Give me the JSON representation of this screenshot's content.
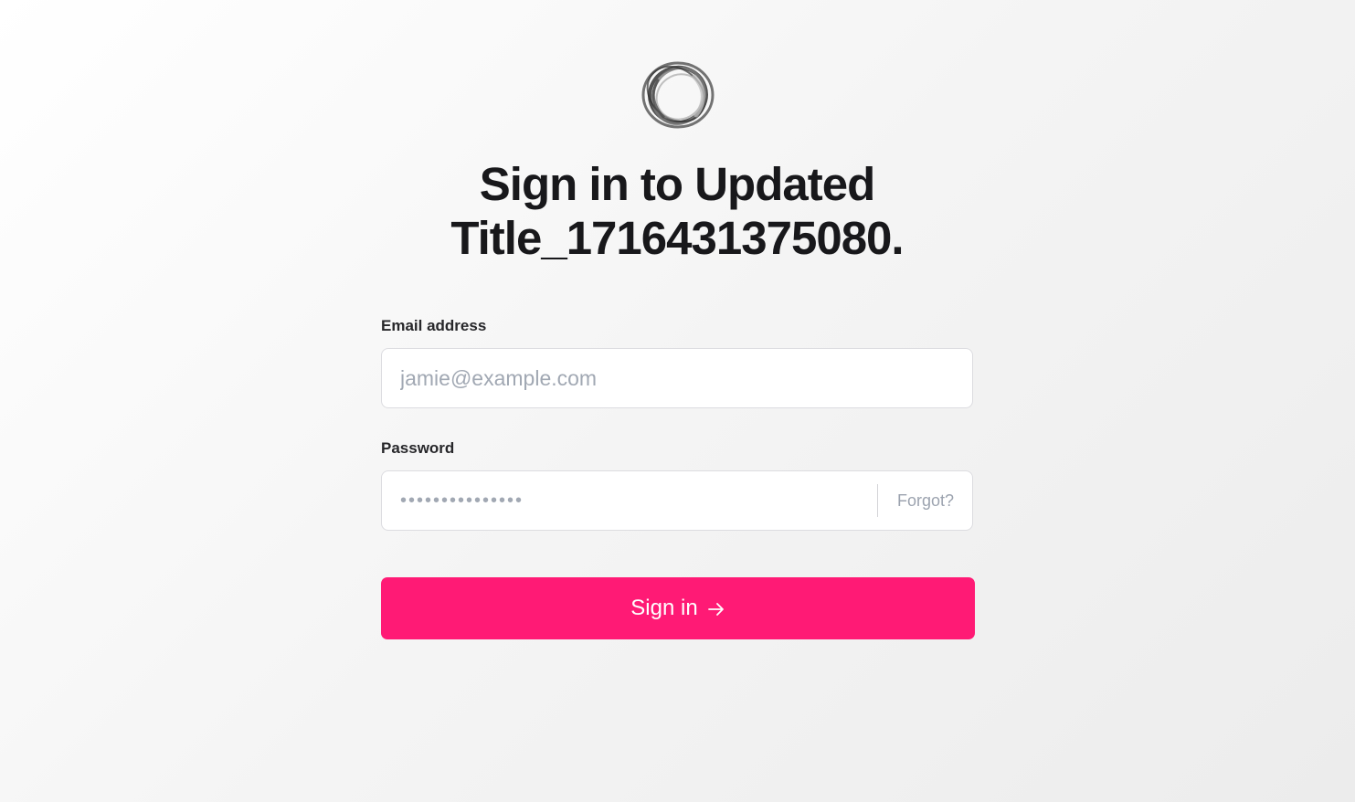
{
  "app": {
    "logo_icon": "ring-logo-icon",
    "title": "Sign in to Updated Title_1716431375080."
  },
  "form": {
    "email": {
      "label": "Email address",
      "placeholder": "jamie@example.com",
      "value": ""
    },
    "password": {
      "label": "Password",
      "placeholder": "•••••••••••••••",
      "value": "",
      "forgot_label": "Forgot?"
    },
    "submit": {
      "label": "Sign in",
      "icon": "arrow-right-icon"
    }
  },
  "colors": {
    "accent": "#ff1a75",
    "title_text": "#18181b",
    "placeholder_text": "#a1a8b3"
  }
}
